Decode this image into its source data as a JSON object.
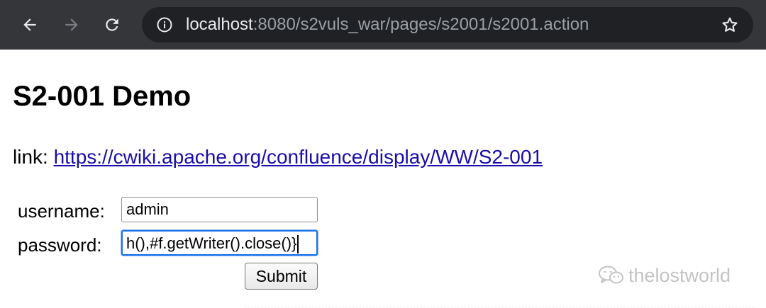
{
  "browser": {
    "url_host": "localhost",
    "url_rest": ":8080/s2vuls_war/pages/s2001/s2001.action",
    "icons": [
      "back-arrow-icon",
      "forward-arrow-icon",
      "reload-icon",
      "info-icon",
      "star-icon"
    ]
  },
  "page": {
    "title": "S2-001 Demo",
    "link_prefix": "link: ",
    "link_text": "https://cwiki.apache.org/confluence/display/WW/S2-001"
  },
  "form": {
    "username_label": "username:",
    "username_value": "admin",
    "password_label": "password:",
    "password_value": "h(),#f.getWriter().close()}",
    "submit_label": "Submit"
  },
  "watermark": {
    "text": "thelostworld",
    "icon": "wechat-icon"
  },
  "colors": {
    "toolbar": "#35363a",
    "omnibox": "#202124",
    "link": "#1a0dab",
    "focus_ring": "#1a73e8"
  }
}
